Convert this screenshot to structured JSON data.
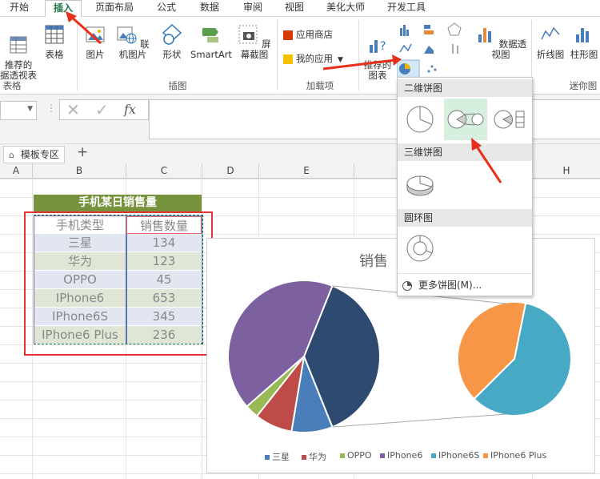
{
  "menu_tabs": [
    "开始",
    "插入",
    "页面布局",
    "公式",
    "数据",
    "审阅",
    "视图",
    "美化大师",
    "开发工具"
  ],
  "ribbon": {
    "recommended_pivot": "推荐的\n据透视表",
    "table": "表格",
    "pictures": "图片",
    "online_pictures": "联机图片",
    "shapes": "形状",
    "smartart": "SmartArt",
    "screenshot": "屏幕截图",
    "app_store": "应用商店",
    "my_apps": "我的应用",
    "recommended_charts": "推荐的\n图表",
    "pivot_chart": "数据透视图",
    "line": "折线图",
    "column": "柱形图",
    "group_tables": "表格",
    "group_illustrations": "插图",
    "group_addins": "加载项",
    "group_sparklines": "迷你图"
  },
  "formula_bar": {
    "fx": "fx"
  },
  "sheet_tabs": {
    "template_zone": "模板专区",
    "add": "+"
  },
  "columns": [
    "A",
    "B",
    "C",
    "D",
    "E",
    "H"
  ],
  "table": {
    "title": "手机某日销售量",
    "header_type": "手机类型",
    "header_qty": "销售数量",
    "rows": [
      {
        "name": "三星",
        "qty": "134"
      },
      {
        "name": "华为",
        "qty": "123"
      },
      {
        "name": "OPPO",
        "qty": "45"
      },
      {
        "name": "IPhone6",
        "qty": "653"
      },
      {
        "name": "IPhone6S",
        "qty": "345"
      },
      {
        "name": "IPhone6 Plus",
        "qty": "236"
      }
    ]
  },
  "dropdown": {
    "section_2d": "二维饼图",
    "section_3d": "三维饼图",
    "section_donut": "圆环图",
    "more": "更多饼图(M)..."
  },
  "chart_data": {
    "type": "pie",
    "subtype": "pie-of-pie",
    "title": "销售",
    "categories": [
      "三星",
      "华为",
      "OPPO",
      "IPhone6",
      "IPhone6S",
      "IPhone6 Plus"
    ],
    "values": [
      134,
      123,
      45,
      653,
      345,
      236
    ],
    "colors": [
      "#4a7ebb",
      "#be4b48",
      "#98b954",
      "#7d60a0",
      "#46aac5",
      "#f79646"
    ],
    "legend_position": "bottom"
  },
  "colors": {
    "title_bg": "#76923c",
    "accent_green": "#217346",
    "arrow_red": "#e8301c",
    "selection_red": "#e53333"
  }
}
